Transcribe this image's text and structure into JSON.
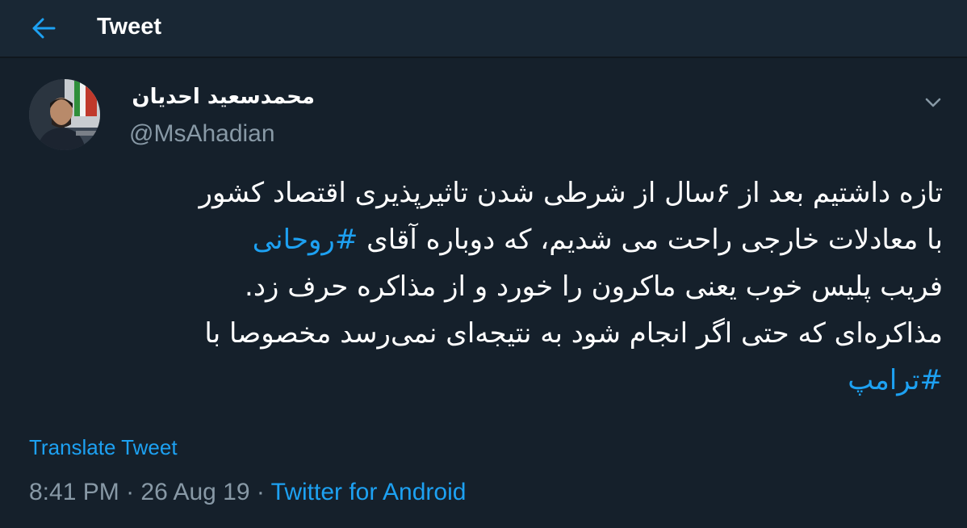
{
  "header": {
    "title": "Tweet",
    "back_icon": "back-arrow-icon",
    "accent": "#1da1f2"
  },
  "tweet": {
    "author_name": "محمدسعید احدیان",
    "handle": "@MsAhadian",
    "lines": {
      "l1": "تازه داشتیم بعد از ۶سال از شرطی شدن تاثیرپذیری اقتصاد کشور",
      "l2_pre": "با معادلات خارجی راحت می شدیم، که دوباره آقای ",
      "l2_tag": "#روحانی",
      "l3": "فریب پلیس خوب یعنی ماکرون را خورد و از مذاکره حرف زد.",
      "l4": "مذاکره‌ای که حتی اگر انجام شود به نتیجه‌ای نمی‌رسد مخصوصا با",
      "l5_tag": "#ترامپ"
    },
    "translate_label": "Translate Tweet",
    "time": "8:41 PM",
    "sep1": " · ",
    "date": "26 Aug 19",
    "sep2": " · ",
    "source": "Twitter for Android"
  },
  "colors": {
    "background": "#15202b",
    "header_bg": "#192734",
    "text": "#ffffff",
    "muted": "#8899a6",
    "link": "#1da1f2"
  }
}
